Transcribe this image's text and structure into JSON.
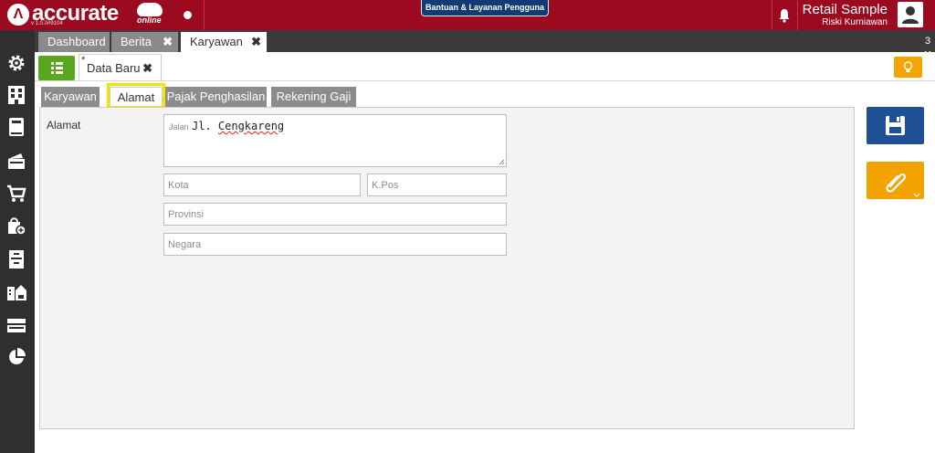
{
  "app": {
    "logo_text": "accurate",
    "logo_sub": "online",
    "version": "v 1.0.0#9104",
    "help_button": "Bantuan & Layanan Pengguna",
    "company_name": "Retail Sample",
    "user_name": "Riski Kurniawan"
  },
  "module_tabs": [
    {
      "label": "Dashboard",
      "closable": false
    },
    {
      "label": "Berita",
      "closable": true,
      "close_glyph": "✖"
    },
    {
      "label": "Karyawan",
      "closable": true,
      "close_glyph": "✖",
      "active": true
    }
  ],
  "tab_count": "3",
  "tab_count_icon": "chevron-down-icon",
  "doc_tab": {
    "modified_marker": "*",
    "label": "Data Baru",
    "close_glyph": "✖"
  },
  "sub_tabs": [
    {
      "label": "Karyawan"
    },
    {
      "label": "Alamat",
      "active": true
    },
    {
      "label": "Pajak Penghasilan"
    },
    {
      "label": "Rekening Gaji"
    }
  ],
  "form": {
    "section_label": "Alamat",
    "street_prefix": "Jalan",
    "street_value_prefix": "Jl. ",
    "street_value_word": "Cengkareng",
    "city_placeholder": "Kota",
    "postal_placeholder": "K.Pos",
    "province_placeholder": "Provinsi",
    "country_placeholder": "Negara"
  },
  "sidebar_icons": [
    "settings-icon",
    "company-icon",
    "ledger-icon",
    "payment-icon",
    "cart-icon",
    "sales-bag-icon",
    "inventory-icon",
    "asset-icon",
    "tax-icon",
    "report-pie-icon"
  ],
  "colors": {
    "brand": "#9b0a1f",
    "save": "#1f4f95",
    "attach": "#f2a300",
    "list_button": "#5aa61e",
    "highlight": "#f2e500"
  }
}
